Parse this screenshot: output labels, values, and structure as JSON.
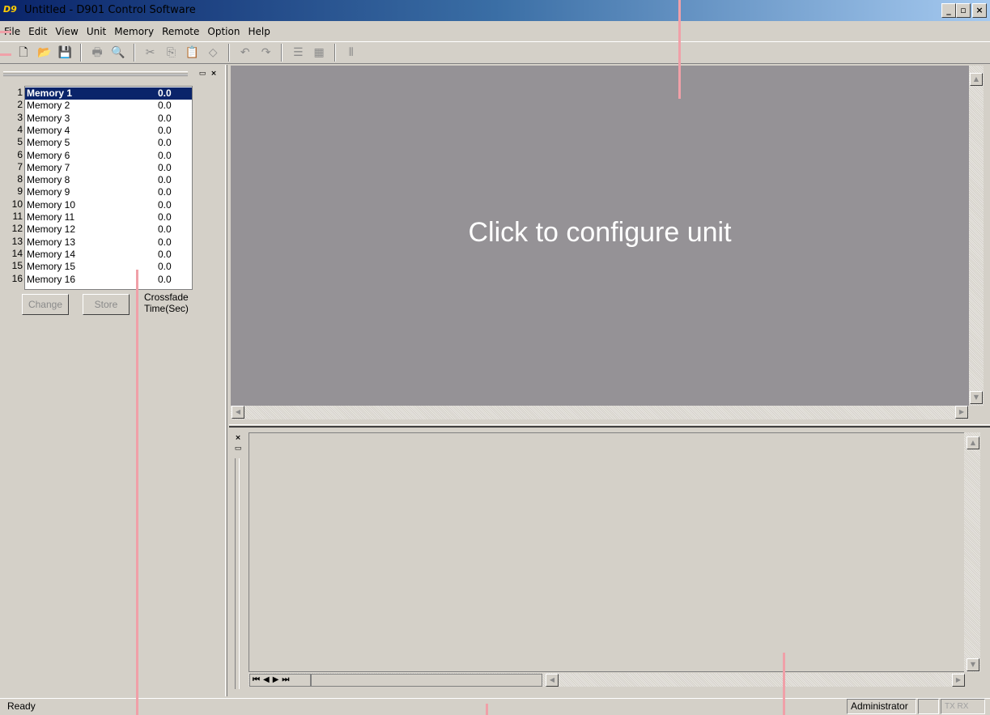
{
  "window": {
    "app_icon_text": "D9",
    "title": "Untitled - D901 Control Software",
    "minimize": "_",
    "maximize": "▫",
    "close": "×"
  },
  "menu": [
    "File",
    "Edit",
    "View",
    "Unit",
    "Memory",
    "Remote",
    "Option",
    "Help"
  ],
  "toolbar": {
    "icons": [
      "new-icon",
      "open-icon",
      "save-icon",
      "print-icon",
      "print-preview-icon",
      "cut-icon",
      "copy-icon",
      "paste-icon",
      "erase-icon",
      "undo-icon",
      "redo-icon",
      "list-icon",
      "grid-icon",
      "columns-icon"
    ]
  },
  "memory_panel": {
    "selected": 1,
    "items": [
      {
        "num": "1",
        "name": "Memory 1",
        "value": "0.0"
      },
      {
        "num": "2",
        "name": "Memory 2",
        "value": "0.0"
      },
      {
        "num": "3",
        "name": "Memory 3",
        "value": "0.0"
      },
      {
        "num": "4",
        "name": "Memory 4",
        "value": "0.0"
      },
      {
        "num": "5",
        "name": "Memory 5",
        "value": "0.0"
      },
      {
        "num": "6",
        "name": "Memory 6",
        "value": "0.0"
      },
      {
        "num": "7",
        "name": "Memory 7",
        "value": "0.0"
      },
      {
        "num": "8",
        "name": "Memory 8",
        "value": "0.0"
      },
      {
        "num": "9",
        "name": "Memory 9",
        "value": "0.0"
      },
      {
        "num": "10",
        "name": "Memory 10",
        "value": "0.0"
      },
      {
        "num": "11",
        "name": "Memory 11",
        "value": "0.0"
      },
      {
        "num": "12",
        "name": "Memory 12",
        "value": "0.0"
      },
      {
        "num": "13",
        "name": "Memory 13",
        "value": "0.0"
      },
      {
        "num": "14",
        "name": "Memory 14",
        "value": "0.0"
      },
      {
        "num": "15",
        "name": "Memory 15",
        "value": "0.0"
      },
      {
        "num": "16",
        "name": "Memory 16",
        "value": "0.0"
      }
    ],
    "change_label": "Change",
    "store_label": "Store",
    "crossfade_line1": "Crossfade",
    "crossfade_line2": "Time(Sec)"
  },
  "config_view": {
    "message": "Click to configure unit",
    "background": "#959296"
  },
  "statusbar": {
    "ready": "Ready",
    "user": "Administrator",
    "txrx": "TX RX"
  }
}
